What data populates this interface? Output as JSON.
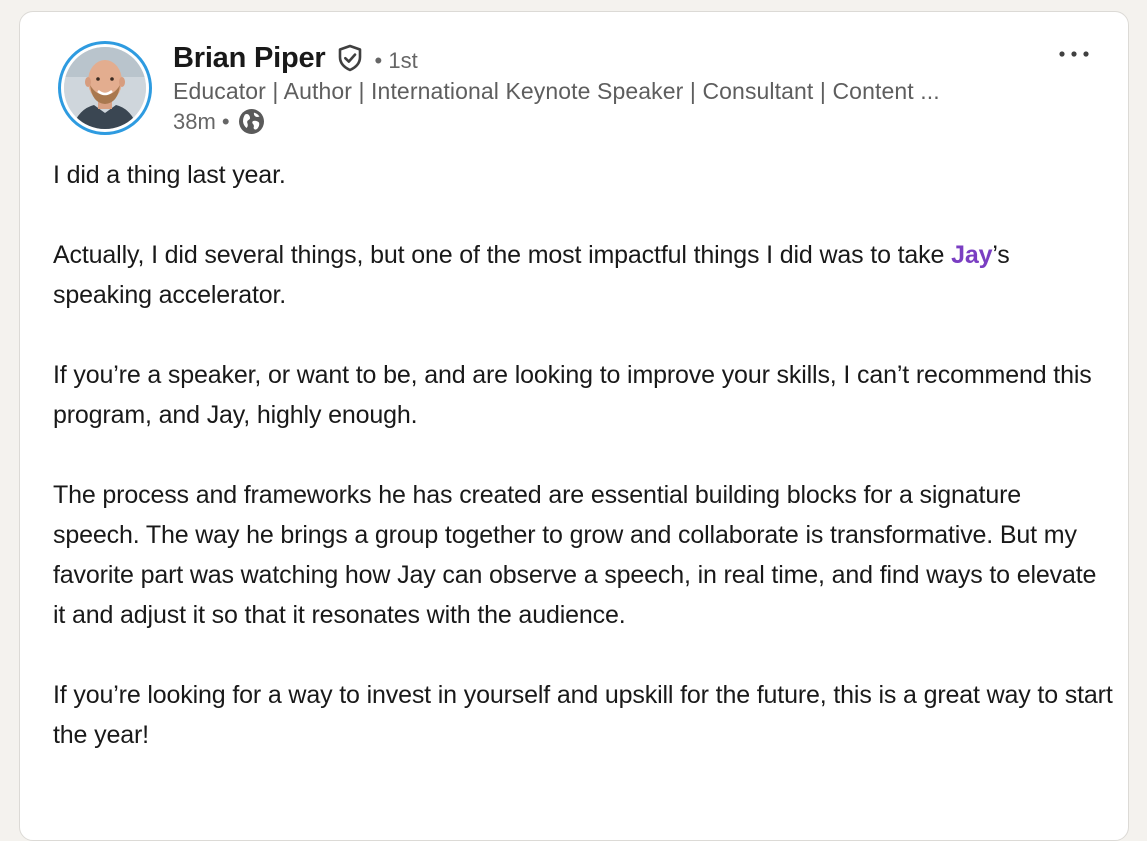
{
  "author": {
    "name": "Brian Piper",
    "connection_degree": "• 1st",
    "headline": "Educator | Author | International Keynote Speaker | Consultant | Content ...",
    "time_posted": "38m •",
    "visibility_icon": "globe-icon",
    "verified_icon": "verified-shield-icon"
  },
  "menu": {
    "icon": "more-horizontal-icon"
  },
  "post": {
    "p1": "I did a thing last year.",
    "p2_before": "Actually, I did several things, but one of the most impactful things I did was to take ",
    "p2_mention": "Jay",
    "p2_after": "’s speaking accelerator.",
    "p3": "If you’re a speaker, or want to be, and are looking to improve your skills, I can’t recommend this program, and Jay, highly enough.",
    "p4": "The process and frameworks he has created are essential building blocks for a signature speech. The way he brings a group together to grow and collaborate is transformative. But my favorite part was watching how Jay can observe a speech, in real time, and find ways to elevate it and adjust it so that it resonates with the audience.",
    "p5": "If you’re looking for a way to invest in yourself and upskill for the future, this is a great way to start the year!"
  },
  "colors": {
    "mention": "#7a3ec2",
    "avatar_ring": "#2e9be0",
    "secondary_text": "#666666",
    "background": "#f4f2ee"
  }
}
